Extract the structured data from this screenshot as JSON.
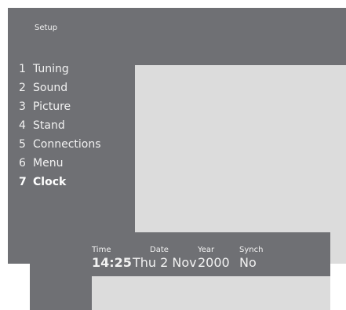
{
  "setup": {
    "title": "Setup",
    "items": [
      {
        "num": "1",
        "label": "Tuning"
      },
      {
        "num": "2",
        "label": "Sound"
      },
      {
        "num": "3",
        "label": "Picture"
      },
      {
        "num": "4",
        "label": "Stand"
      },
      {
        "num": "5",
        "label": "Connections"
      },
      {
        "num": "6",
        "label": "Menu"
      },
      {
        "num": "7",
        "label": "Clock"
      }
    ],
    "selected": "Clock"
  },
  "clock": {
    "time_label": "Time",
    "time_value": "14:25",
    "date_label": "Date",
    "date_value": "Thu 2 Nov",
    "year_label": "Year",
    "year_value": "2000",
    "synch_label": "Synch",
    "synch_value": "No"
  },
  "colors": {
    "panel": "#6f7074",
    "display": "#dcdcdc",
    "text": "#f2f2f2"
  }
}
